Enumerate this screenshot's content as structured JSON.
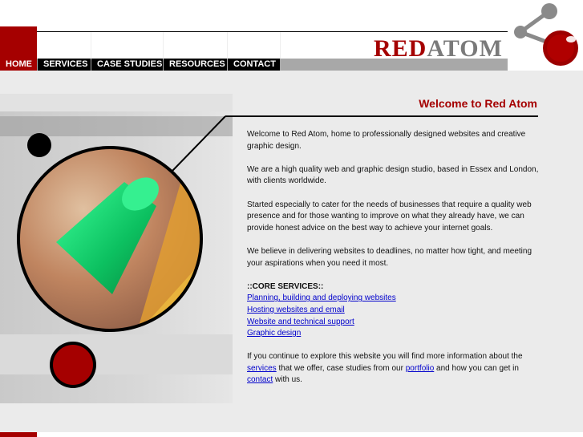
{
  "nav": {
    "items": [
      {
        "label": "HOME",
        "active": true
      },
      {
        "label": "SERVICES",
        "active": false
      },
      {
        "label": "CASE STUDIES",
        "active": false
      },
      {
        "label": "RESOURCES",
        "active": false
      },
      {
        "label": "CONTACT",
        "active": false
      }
    ]
  },
  "logo": {
    "red": "RED",
    "grey": "ATOM"
  },
  "main": {
    "title": "Welcome to Red Atom",
    "p1": "Welcome to Red Atom, home to professionally designed websites and creative graphic design.",
    "p2": "We are a high quality web and graphic design studio, based in Essex and London, with clients worldwide.",
    "p3": "Started especially to cater for the needs of businesses that require a quality web presence and for those wanting to improve on what they already have, we can provide honest advice on the best way to achieve your internet goals.",
    "p4": "We believe in delivering websites to deadlines, no matter how tight, and meeting your aspirations when you need it most.",
    "core_heading": "::CORE SERVICES::",
    "services": [
      "Planning, building and deploying websites",
      "Hosting websites and email",
      "Website and technical support",
      "Graphic design"
    ],
    "closing": {
      "part1": "If you continue to explore this website you will find more information about the ",
      "link1": "services",
      "part2": " that we offer, case studies from our ",
      "link2": "portfolio",
      "part3": " and how you can get in ",
      "link3": "contact",
      "part4": " with us."
    }
  },
  "colors": {
    "brand_red": "#a50000",
    "nav_bg": "#000000",
    "link": "#0000cc"
  }
}
